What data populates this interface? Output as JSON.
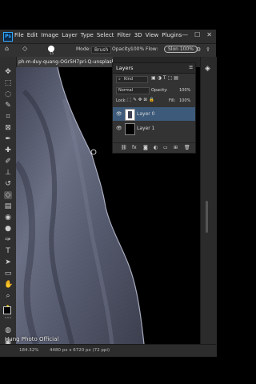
{
  "app": {
    "logo": "Ps"
  },
  "menu": [
    "File",
    "Edit",
    "Image",
    "Layer",
    "Type",
    "Select",
    "Filter",
    "3D",
    "View",
    "Plugins"
  ],
  "window_controls": [
    "—",
    "☐",
    "✕"
  ],
  "options": {
    "brush_size": "15",
    "mode_label": "Mode:",
    "mode_value": "Brush",
    "opacity_label": "Opacity:",
    "opacity_value": "100%",
    "flow_label": "Flow:",
    "flow_value": "100%",
    "sharing_pill": "Slon 100%"
  },
  "document": {
    "tab_title": "ph-m-duy-quang-OGr5H7pri-Q-unsplash.jpg @..."
  },
  "layers_panel": {
    "title": "Layers",
    "kind_label": "Kind",
    "blend_mode": "Normal",
    "opacity_label": "Opacity:",
    "opacity_value": "100%",
    "lock_label": "Lock:",
    "fill_label": "Fill:",
    "fill_value": "100%",
    "layers": [
      {
        "name": "Layer 0",
        "selected": true
      },
      {
        "name": "Layer 1",
        "selected": false
      }
    ],
    "footer_icons": [
      "link-icon",
      "fx-icon",
      "mask-icon",
      "adjustment-icon",
      "group-icon",
      "new-layer-icon",
      "trash-icon"
    ]
  },
  "status": {
    "zoom": "184.32%",
    "doc_info": "4480 px x 6720 px (72 ppi)"
  },
  "watermark": "Hung Photo Official",
  "colors": {
    "accent": "#31a8ff",
    "selected_layer": "#3d5a7a",
    "fabric": "#5d6276"
  }
}
